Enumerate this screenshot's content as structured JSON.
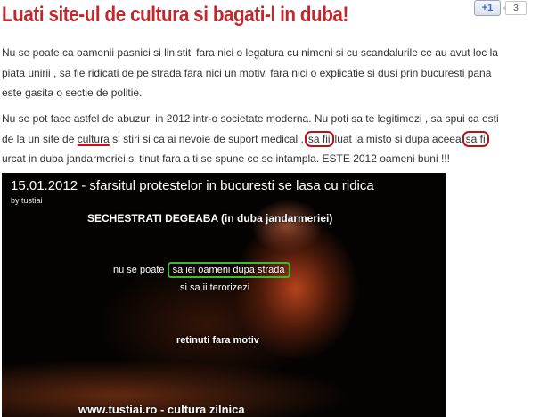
{
  "post": {
    "title": "Luati site-ul de cultura si bagati-l in duba!"
  },
  "social": {
    "plus_one_label": "+1",
    "count": "3"
  },
  "paragraph1": {
    "line1": "Nu se poate ca oamenii pasnici si linistiti fara nici o legatura cu nimeni si cu scandalurile ce au avut loc la",
    "line2": "piata unirii , sa fie ridicati de pe strada fara nici un motiv, fara nici o explicatie  si dusi prin bucuresti pana",
    "line3": "este gasita o sectie de politie."
  },
  "paragraph2": {
    "line1": "Nu se pot face astfel de abuzuri in 2012 intr-o societate moderna. Nu poti sa te legitimezi , sa spui ca esti",
    "line2_a": "de la un site de ",
    "line2_link": "cultura",
    "line2_b": " si stiri si ca ai nevoie de suport medical ,",
    "line2_circle1": "sa fii",
    "line2_c": "luat la misto si dupa aceea",
    "line2_circle2": "sa fi",
    "line3": "urcat in duba jandarmeriei si tinut fara a ti se spune ce se intampla. ESTE 2012 oameni buni !!!"
  },
  "video": {
    "title": "15.01.2012 - sfarsitul protestelor in bucuresti se lasa cu ridica",
    "byline": "by tustiai",
    "overlay1": "SECHESTRATI DEGEABA (in duba jandarmeriei)",
    "overlay2_a": "nu se poate",
    "overlay2_b": "sa iei oameni dupa strada",
    "overlay3": "si sa ii terorizezi",
    "overlay4": "retinuti fara motiv",
    "overlay5": "www.tustiai.ro - cultura zilnica"
  }
}
